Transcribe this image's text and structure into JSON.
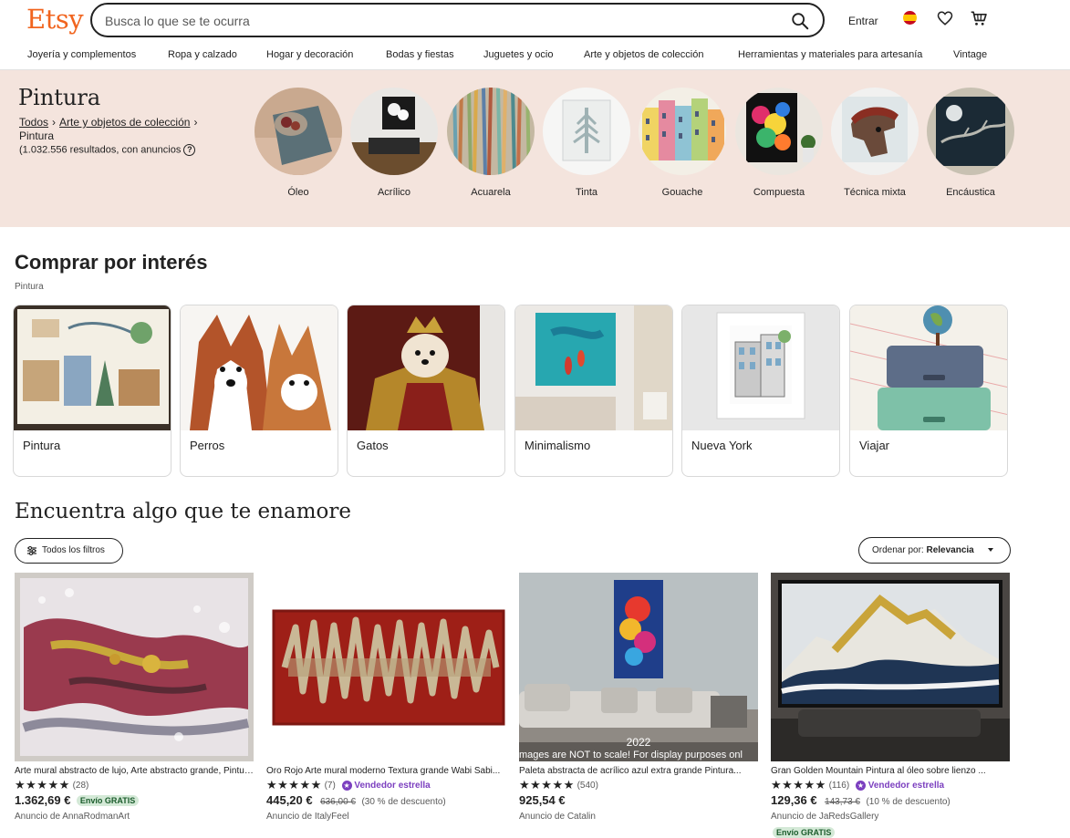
{
  "brand": {
    "logo": "Etsy",
    "accent": "#f1641e"
  },
  "search": {
    "placeholder": "Busca lo que se te ocurra",
    "icon": "search-icon"
  },
  "header_actions": {
    "signin": "Entrar",
    "flag": "spain-flag-icon",
    "favorites": "heart-icon",
    "cart": "cart-icon"
  },
  "nav": [
    "Joyería y complementos",
    "Ropa y calzado",
    "Hogar y decoración",
    "Bodas y fiestas",
    "Juguetes y ocio",
    "Arte y objetos de colección",
    "Herramientas y materiales para artesanía",
    "Vintage"
  ],
  "banner": {
    "title": "Pintura",
    "crumb_all": "Todos",
    "crumb_parent": "Arte y objetos de colección",
    "crumb_current": "Pintura",
    "results": "(1.032.556 resultados, con anuncios",
    "categories": [
      "Óleo",
      "Acrílico",
      "Acuarela",
      "Tinta",
      "Gouache",
      "Compuesta",
      "Técnica mixta",
      "Encáustica"
    ]
  },
  "interest": {
    "title": "Comprar por interés",
    "subtitle": "Pintura",
    "cards": [
      "Pintura",
      "Perros",
      "Gatos",
      "Minimalismo",
      "Nueva York",
      "Viajar"
    ]
  },
  "find": {
    "title": "Encuentra algo que te enamore",
    "filters_label": "Todos los filtros",
    "sort_label": "Ordenar por:",
    "sort_value": "Relevancia"
  },
  "listings": [
    {
      "title": "Arte mural abstracto de lujo, Arte abstracto grande, Pintura abstracta...",
      "stars": "★★★★★",
      "reviews": "(28)",
      "star_seller": "",
      "price": "1.362,69 €",
      "old_price": "",
      "discount": "",
      "free_shipping_inline": "Envío GRATIS",
      "seller": "Anuncio de AnnaRodmanArt",
      "free_shipping_below": ""
    },
    {
      "title": "Oro Rojo Arte mural moderno Textura grande Wabi Sabi...",
      "stars": "★★★★★",
      "reviews": "(7)",
      "star_seller": "Vendedor estrella",
      "price": "445,20 €",
      "old_price": "636,00 €",
      "discount": "(30 % de descuento)",
      "free_shipping_inline": "",
      "seller": "Anuncio de ItalyFeel",
      "free_shipping_below": ""
    },
    {
      "title": "Paleta abstracta de acrílico azul extra grande Pintura...",
      "stars": "★★★★★",
      "reviews": "(540)",
      "star_seller": "",
      "price": "925,54 €",
      "old_price": "",
      "discount": "",
      "free_shipping_inline": "",
      "seller": "Anuncio de Catalin",
      "free_shipping_below": ""
    },
    {
      "title": "Gran Golden Mountain Pintura al óleo sobre lienzo ...",
      "stars": "★★★★★",
      "reviews": "(116)",
      "star_seller": "Vendedor estrella",
      "price": "129,36 €",
      "old_price": "143,73 €",
      "discount": "(10 % de descuento)",
      "free_shipping_inline": "",
      "seller": "Anuncio de JaRedsGallery",
      "free_shipping_below": "Envío GRATIS"
    }
  ],
  "overlay_texts": {
    "listing3_year": "2022",
    "listing3_notice": "mages are NOT to scale! For display purposes onl"
  }
}
